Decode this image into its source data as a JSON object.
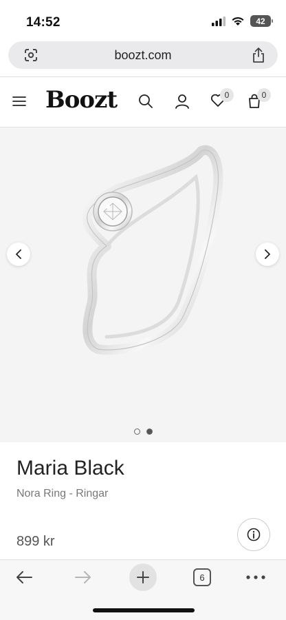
{
  "status_bar": {
    "time": "14:52",
    "battery": "42"
  },
  "browser": {
    "url": "boozt.com",
    "tab_count": "6"
  },
  "header": {
    "logo": "Boozt",
    "wishlist_count": "0",
    "cart_count": "0"
  },
  "gallery": {
    "total_images": 2,
    "active_index": 1
  },
  "product": {
    "brand": "Maria Black",
    "name": "Nora Ring - Ringar",
    "price": "899 kr"
  },
  "colors": {
    "accent": "#111111",
    "gallery_bg": "#f4f4f4",
    "urlbar_bg": "#eaeaec"
  },
  "icons": [
    "google-lens-icon",
    "share-icon",
    "menu-icon",
    "search-icon",
    "account-icon",
    "heart-icon",
    "bag-icon",
    "chevron-left-icon",
    "chevron-right-icon",
    "info-icon",
    "back-icon",
    "forward-icon",
    "plus-icon",
    "tabs-icon",
    "more-icon"
  ]
}
